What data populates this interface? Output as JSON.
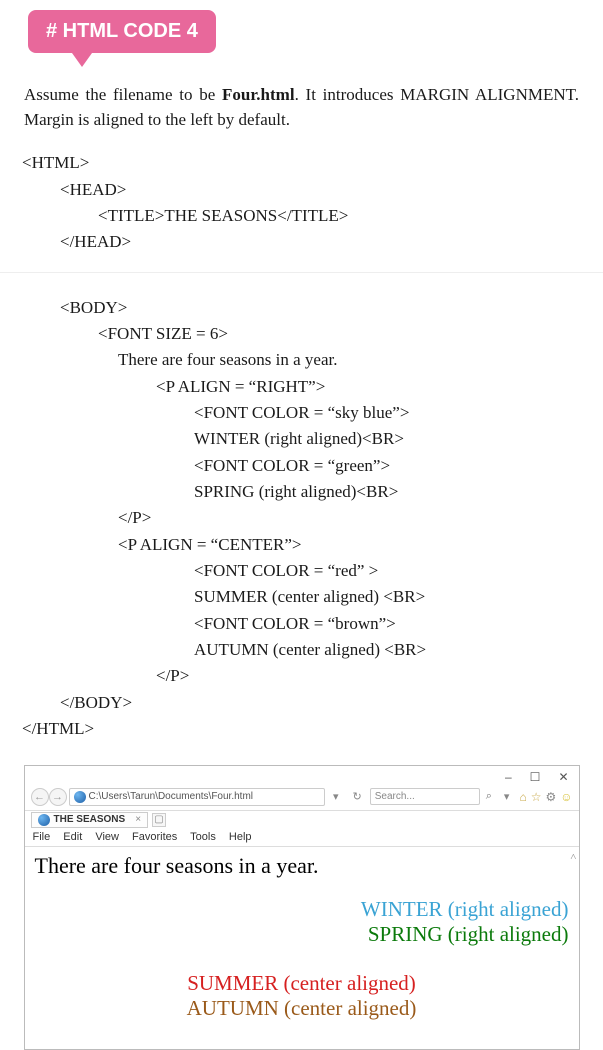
{
  "banner": "# HTML CODE 4",
  "intro_1": "Assume the filename to be ",
  "intro_bold": "Four.html",
  "intro_2": ". It introduces MARGIN ALIGNMENT. Margin is aligned to the left by default.",
  "code": {
    "l1": "<HTML>",
    "l2": "<HEAD>",
    "l3": "<TITLE>THE SEASONS</TITLE>",
    "l4": "</HEAD>",
    "l5": "<BODY>",
    "l6": "<FONT SIZE = 6>",
    "l7": "There are four seasons in a year.",
    "l8": "<P ALIGN = “RIGHT”>",
    "l9": "<FONT COLOR = “sky blue”>",
    "l10": "WINTER (right aligned)<BR>",
    "l11": "<FONT COLOR = “green”>",
    "l12": "SPRING (right aligned)<BR>",
    "l13": "</P>",
    "l14": "<P ALIGN = “CENTER”>",
    "l15": "<FONT COLOR = “red” >",
    "l16": "SUMMER (center aligned) <BR>",
    "l17": "<FONT COLOR = “brown”>",
    "l18": "AUTUMN (center aligned) <BR>",
    "l19": "</P>",
    "l20": "</BODY>",
    "l21": "</HTML>"
  },
  "browser": {
    "win_min": "–",
    "win_max": "☐",
    "win_close": "✕",
    "back": "←",
    "fwd": "→",
    "path": "C:\\Users\\Tarun\\Documents\\Four.html",
    "search_placeholder": "Search...",
    "mag": "⌕",
    "dropdown": "▾",
    "tab_title": "THE SEASONS",
    "tab_close": "×",
    "scroll_up": "˄",
    "menu": {
      "file": "File",
      "edit": "Edit",
      "view": "View",
      "favorites": "Favorites",
      "tools": "Tools",
      "help": "Help"
    }
  },
  "preview": {
    "first": "There are four seasons in a year.",
    "winter": "WINTER (right aligned)",
    "spring": "SPRING (right aligned)",
    "summer": "SUMMER (center aligned)",
    "autumn": "AUTUMN (center aligned)"
  }
}
